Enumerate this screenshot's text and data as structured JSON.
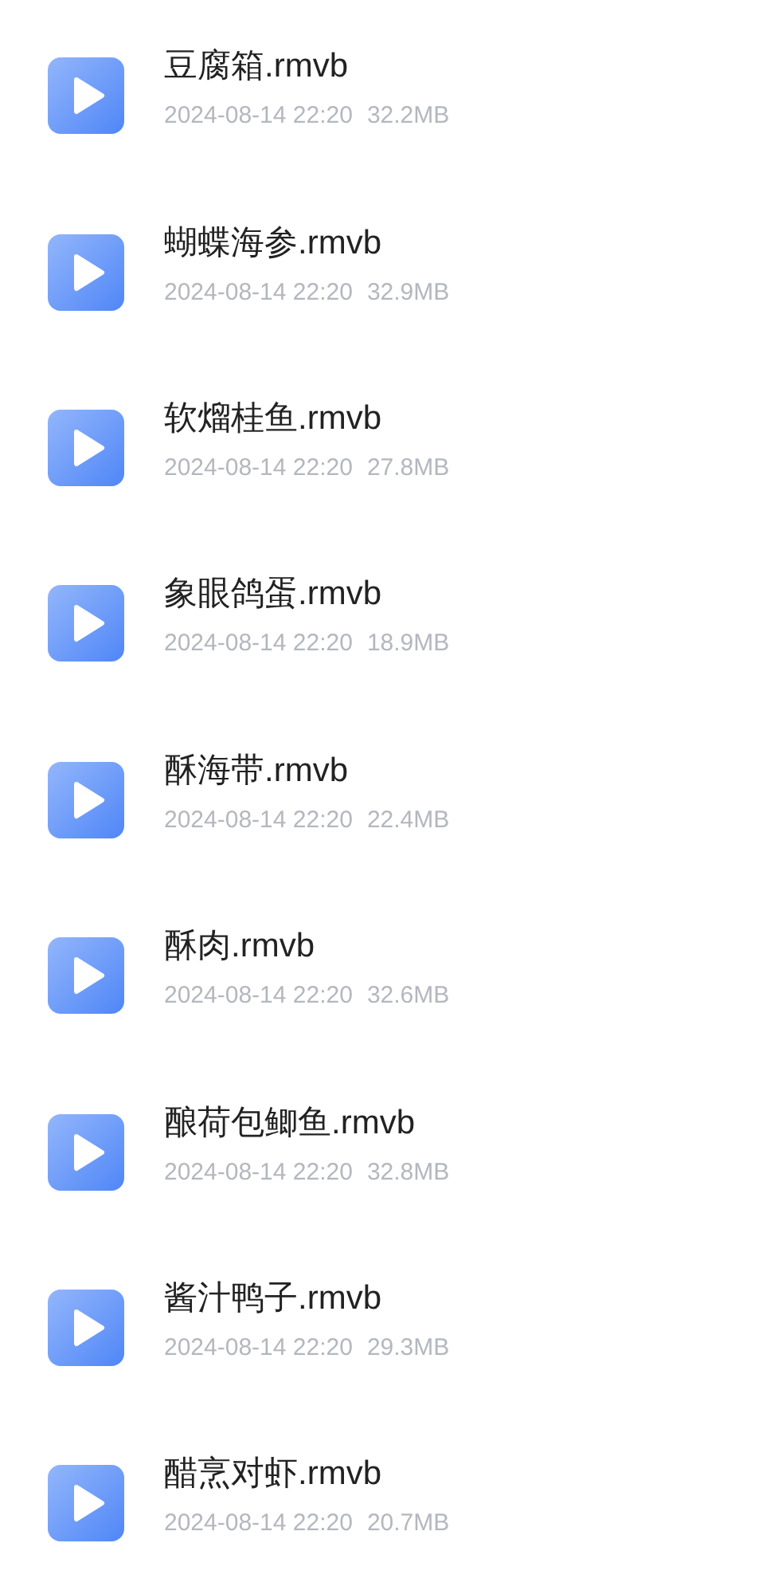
{
  "files": [
    {
      "name": "豆腐箱.rmvb",
      "date": "2024-08-14 22:20",
      "size": "32.2MB"
    },
    {
      "name": "蝴蝶海参.rmvb",
      "date": "2024-08-14 22:20",
      "size": "32.9MB"
    },
    {
      "name": "软熘桂鱼.rmvb",
      "date": "2024-08-14 22:20",
      "size": "27.8MB"
    },
    {
      "name": "象眼鸽蛋.rmvb",
      "date": "2024-08-14 22:20",
      "size": "18.9MB"
    },
    {
      "name": "酥海带.rmvb",
      "date": "2024-08-14 22:20",
      "size": "22.4MB"
    },
    {
      "name": "酥肉.rmvb",
      "date": "2024-08-14 22:20",
      "size": "32.6MB"
    },
    {
      "name": "酿荷包鲫鱼.rmvb",
      "date": "2024-08-14 22:20",
      "size": "32.8MB"
    },
    {
      "name": "酱汁鸭子.rmvb",
      "date": "2024-08-14 22:20",
      "size": "29.3MB"
    },
    {
      "name": "醋烹对虾.rmvb",
      "date": "2024-08-14 22:20",
      "size": "20.7MB"
    }
  ]
}
